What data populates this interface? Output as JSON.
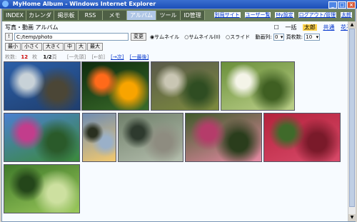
{
  "window": {
    "title": "MyHome Album - Windows Internet Explorer"
  },
  "nav": {
    "tabs": [
      "INDEX",
      "カレンダ",
      "掲示板",
      "RSS",
      "メモ",
      "アルバム",
      "ツール",
      "ID管理"
    ],
    "active_tab": "アルバム",
    "top_links": [
      "別局サイト",
      "ユーザー覧",
      "My設定",
      "ログアウト/管理",
      "太郎"
    ]
  },
  "page": {
    "title": "写真・動画 アルバム",
    "view_options": [
      "一括",
      "太郎",
      "共通",
      "花子"
    ],
    "path_button": "!",
    "path_value": "C:/temp/photo",
    "change_button": "変更",
    "modes": [
      "サムネイル",
      "サムネイル(II)",
      "スライド"
    ],
    "video_label": "動画列:",
    "video_value": "0",
    "per_page_label": "頁枚数:",
    "per_page_value": "10",
    "size_buttons": [
      "最小",
      "小さく",
      "大きく",
      "中",
      "大",
      "最大"
    ],
    "count_label": "枚数:",
    "count_value": "12",
    "count_unit": "枚",
    "page_indicator": "1/2",
    "page_unit": "頁",
    "pager": [
      "[一先頭]",
      "[←前]",
      "[→次]",
      "[一最後]"
    ]
  },
  "photos": [
    {
      "name": "coast-photo",
      "colors": [
        "#2b5fa8",
        "#1f3e6e",
        "#c8d2d8",
        "#4b4636"
      ]
    },
    {
      "name": "orange-flowers-photo",
      "colors": [
        "#0d2b0d",
        "#3a6b2a",
        "#ff6a1a",
        "#f8a400"
      ]
    },
    {
      "name": "vegetables-photo",
      "colors": [
        "#5a5a4a",
        "#7d8b3e",
        "#c9c6b3",
        "#2f4d22"
      ]
    },
    {
      "name": "white-blossoms-photo",
      "colors": [
        "#6a8f3a",
        "#bcd08a",
        "#f4f4e8",
        "#3f5f22"
      ]
    },
    {
      "name": "palm-bougainvillea-photo",
      "colors": [
        "#4a7fd0",
        "#3b8a3b",
        "#c23d8c",
        "#2a5a2a"
      ]
    },
    {
      "name": "dusk-trees-photo",
      "colors": [
        "#6f8db3",
        "#f3c96e",
        "#2a3020",
        "#9ab0c8"
      ]
    },
    {
      "name": "boat-pond-photo",
      "colors": [
        "#6f7f6a",
        "#b5bfae",
        "#2e3a2e",
        "#8e8c80"
      ]
    },
    {
      "name": "pink-bud-photo",
      "colors": [
        "#3f5a2a",
        "#e88aa5",
        "#b53c6a",
        "#2a3d1c"
      ]
    },
    {
      "name": "red-leaves-photo",
      "colors": [
        "#b4233c",
        "#d94a6a",
        "#3f6a2a",
        "#7a1a2a"
      ]
    },
    {
      "name": "green-leaves-photo",
      "colors": [
        "#3f7a2a",
        "#9ac85a",
        "#24461a",
        "#cde0a0"
      ]
    }
  ]
}
